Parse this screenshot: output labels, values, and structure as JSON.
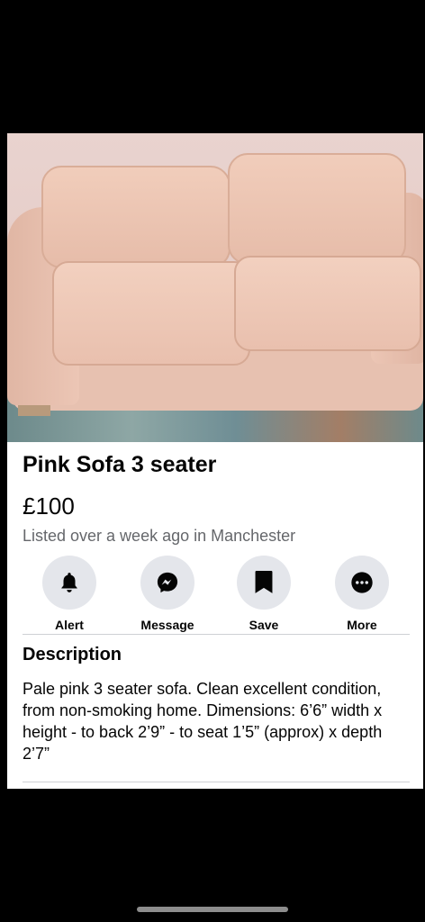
{
  "listing": {
    "title": "Pink Sofa 3 seater",
    "price": "£100",
    "meta": "Listed over a week ago in Manchester"
  },
  "actions": [
    {
      "label": "Alert",
      "icon": "bell-icon"
    },
    {
      "label": "Message",
      "icon": "messenger-icon"
    },
    {
      "label": "Save",
      "icon": "bookmark-icon"
    },
    {
      "label": "More",
      "icon": "more-dots-icon"
    }
  ],
  "description": {
    "heading": "Description",
    "text": "Pale pink 3 seater sofa. Clean excellent condition, from non-smoking home. Dimensions: 6’6” width x height - to back 2’9” - to seat 1’5” (approx) x depth 2’7”"
  },
  "colors": {
    "icon_bg": "#e4e6eb",
    "meta_text": "#65676b",
    "primary_text": "#050505"
  }
}
